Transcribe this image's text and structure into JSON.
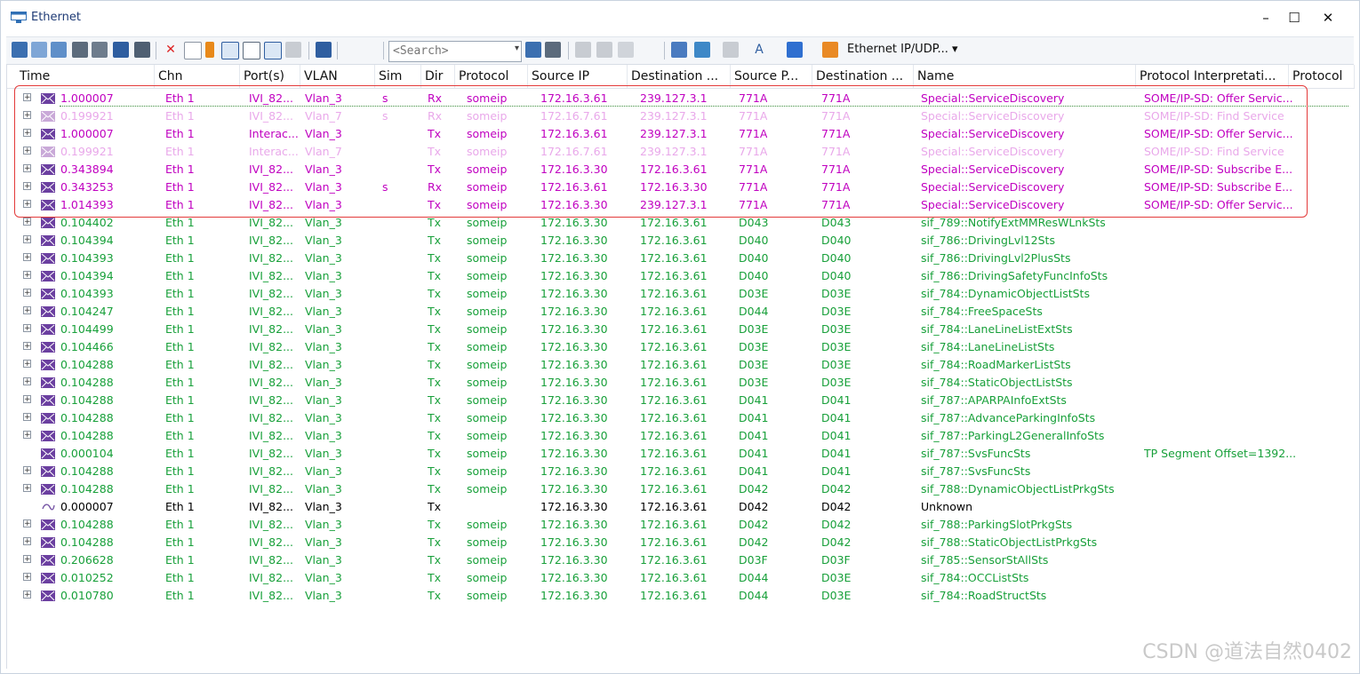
{
  "window": {
    "title": "Ethernet",
    "minimize": "–",
    "maximize": "☐",
    "close": "✕"
  },
  "toolbar": {
    "search_placeholder": "<Search>",
    "protocol_filter_label": "Ethernet IP/UDP... ▾"
  },
  "columns": [
    "Time",
    "Chn",
    "Port(s)",
    "VLAN",
    "Sim",
    "Dir",
    "Protocol",
    "Source IP",
    "Destination ...",
    "Source P...",
    "Destination ...",
    "Name",
    "Protocol Interpretati...",
    "Protocol"
  ],
  "rows": [
    {
      "time": "1.000007",
      "chn": "Eth 1",
      "port": "IVI_82...",
      "vlan": "Vlan_3",
      "sim": "s",
      "dir": "Rx",
      "protocol": "someip",
      "src": "172.16.3.61",
      "dst": "239.127.3.1",
      "sport": "771A",
      "dport": "771A",
      "name": "Special::ServiceDiscovery",
      "interp": "SOME/IP-SD: Offer Servic...",
      "style": "magenta",
      "icon": "envelope"
    },
    {
      "time": "0.199921",
      "chn": "Eth 1",
      "port": "IVI_82...",
      "vlan": "Vlan_7",
      "sim": "s",
      "dir": "Rx",
      "protocol": "someip",
      "src": "172.16.7.61",
      "dst": "239.127.3.1",
      "sport": "771A",
      "dport": "771A",
      "name": "Special::ServiceDiscovery",
      "interp": "SOME/IP-SD: Find Service",
      "style": "faded",
      "icon": "envelope"
    },
    {
      "time": "1.000007",
      "chn": "Eth 1",
      "port": "Interac...",
      "vlan": "Vlan_3",
      "sim": "",
      "dir": "Tx",
      "protocol": "someip",
      "src": "172.16.3.61",
      "dst": "239.127.3.1",
      "sport": "771A",
      "dport": "771A",
      "name": "Special::ServiceDiscovery",
      "interp": "SOME/IP-SD: Offer Servic...",
      "style": "magenta",
      "icon": "envelope"
    },
    {
      "time": "0.199921",
      "chn": "Eth 1",
      "port": "Interac...",
      "vlan": "Vlan_7",
      "sim": "",
      "dir": "Tx",
      "protocol": "someip",
      "src": "172.16.7.61",
      "dst": "239.127.3.1",
      "sport": "771A",
      "dport": "771A",
      "name": "Special::ServiceDiscovery",
      "interp": "SOME/IP-SD: Find Service",
      "style": "faded",
      "icon": "envelope"
    },
    {
      "time": "0.343894",
      "chn": "Eth 1",
      "port": "IVI_82...",
      "vlan": "Vlan_3",
      "sim": "",
      "dir": "Tx",
      "protocol": "someip",
      "src": "172.16.3.30",
      "dst": "172.16.3.61",
      "sport": "771A",
      "dport": "771A",
      "name": "Special::ServiceDiscovery",
      "interp": "SOME/IP-SD: Subscribe E...",
      "style": "magenta",
      "icon": "envelope"
    },
    {
      "time": "0.343253",
      "chn": "Eth 1",
      "port": "IVI_82...",
      "vlan": "Vlan_3",
      "sim": "s",
      "dir": "Rx",
      "protocol": "someip",
      "src": "172.16.3.61",
      "dst": "172.16.3.30",
      "sport": "771A",
      "dport": "771A",
      "name": "Special::ServiceDiscovery",
      "interp": "SOME/IP-SD: Subscribe E...",
      "style": "magenta",
      "icon": "envelope"
    },
    {
      "time": "1.014393",
      "chn": "Eth 1",
      "port": "IVI_82...",
      "vlan": "Vlan_3",
      "sim": "",
      "dir": "Tx",
      "protocol": "someip",
      "src": "172.16.3.30",
      "dst": "239.127.3.1",
      "sport": "771A",
      "dport": "771A",
      "name": "Special::ServiceDiscovery",
      "interp": "SOME/IP-SD: Offer Servic...",
      "style": "magenta",
      "icon": "envelope"
    },
    {
      "time": "0.104402",
      "chn": "Eth 1",
      "port": "IVI_82...",
      "vlan": "Vlan_3",
      "sim": "",
      "dir": "Tx",
      "protocol": "someip",
      "src": "172.16.3.30",
      "dst": "172.16.3.61",
      "sport": "D043",
      "dport": "D043",
      "name": "sif_789::NotifyExtMMResWLnkSts",
      "interp": "",
      "style": "green",
      "icon": "envelope"
    },
    {
      "time": "0.104394",
      "chn": "Eth 1",
      "port": "IVI_82...",
      "vlan": "Vlan_3",
      "sim": "",
      "dir": "Tx",
      "protocol": "someip",
      "src": "172.16.3.30",
      "dst": "172.16.3.61",
      "sport": "D040",
      "dport": "D040",
      "name": "sif_786::DrivingLvl12Sts",
      "interp": "",
      "style": "green",
      "icon": "envelope"
    },
    {
      "time": "0.104393",
      "chn": "Eth 1",
      "port": "IVI_82...",
      "vlan": "Vlan_3",
      "sim": "",
      "dir": "Tx",
      "protocol": "someip",
      "src": "172.16.3.30",
      "dst": "172.16.3.61",
      "sport": "D040",
      "dport": "D040",
      "name": "sif_786::DrivingLvl2PlusSts",
      "interp": "",
      "style": "green",
      "icon": "envelope"
    },
    {
      "time": "0.104394",
      "chn": "Eth 1",
      "port": "IVI_82...",
      "vlan": "Vlan_3",
      "sim": "",
      "dir": "Tx",
      "protocol": "someip",
      "src": "172.16.3.30",
      "dst": "172.16.3.61",
      "sport": "D040",
      "dport": "D040",
      "name": "sif_786::DrivingSafetyFuncInfoSts",
      "interp": "",
      "style": "green",
      "icon": "envelope"
    },
    {
      "time": "0.104393",
      "chn": "Eth 1",
      "port": "IVI_82...",
      "vlan": "Vlan_3",
      "sim": "",
      "dir": "Tx",
      "protocol": "someip",
      "src": "172.16.3.30",
      "dst": "172.16.3.61",
      "sport": "D03E",
      "dport": "D03E",
      "name": "sif_784::DynamicObjectListSts",
      "interp": "",
      "style": "green",
      "icon": "envelope"
    },
    {
      "time": "0.104247",
      "chn": "Eth 1",
      "port": "IVI_82...",
      "vlan": "Vlan_3",
      "sim": "",
      "dir": "Tx",
      "protocol": "someip",
      "src": "172.16.3.30",
      "dst": "172.16.3.61",
      "sport": "D044",
      "dport": "D03E",
      "name": "sif_784::FreeSpaceSts",
      "interp": "",
      "style": "green",
      "icon": "envelope"
    },
    {
      "time": "0.104499",
      "chn": "Eth 1",
      "port": "IVI_82...",
      "vlan": "Vlan_3",
      "sim": "",
      "dir": "Tx",
      "protocol": "someip",
      "src": "172.16.3.30",
      "dst": "172.16.3.61",
      "sport": "D03E",
      "dport": "D03E",
      "name": "sif_784::LaneLineListExtSts",
      "interp": "",
      "style": "green",
      "icon": "envelope"
    },
    {
      "time": "0.104466",
      "chn": "Eth 1",
      "port": "IVI_82...",
      "vlan": "Vlan_3",
      "sim": "",
      "dir": "Tx",
      "protocol": "someip",
      "src": "172.16.3.30",
      "dst": "172.16.3.61",
      "sport": "D03E",
      "dport": "D03E",
      "name": "sif_784::LaneLineListSts",
      "interp": "",
      "style": "green",
      "icon": "envelope"
    },
    {
      "time": "0.104288",
      "chn": "Eth 1",
      "port": "IVI_82...",
      "vlan": "Vlan_3",
      "sim": "",
      "dir": "Tx",
      "protocol": "someip",
      "src": "172.16.3.30",
      "dst": "172.16.3.61",
      "sport": "D03E",
      "dport": "D03E",
      "name": "sif_784::RoadMarkerListSts",
      "interp": "",
      "style": "green",
      "icon": "envelope"
    },
    {
      "time": "0.104288",
      "chn": "Eth 1",
      "port": "IVI_82...",
      "vlan": "Vlan_3",
      "sim": "",
      "dir": "Tx",
      "protocol": "someip",
      "src": "172.16.3.30",
      "dst": "172.16.3.61",
      "sport": "D03E",
      "dport": "D03E",
      "name": "sif_784::StaticObjectListSts",
      "interp": "",
      "style": "green",
      "icon": "envelope"
    },
    {
      "time": "0.104288",
      "chn": "Eth 1",
      "port": "IVI_82...",
      "vlan": "Vlan_3",
      "sim": "",
      "dir": "Tx",
      "protocol": "someip",
      "src": "172.16.3.30",
      "dst": "172.16.3.61",
      "sport": "D041",
      "dport": "D041",
      "name": "sif_787::APARPAInfoExtSts",
      "interp": "",
      "style": "green",
      "icon": "envelope"
    },
    {
      "time": "0.104288",
      "chn": "Eth 1",
      "port": "IVI_82...",
      "vlan": "Vlan_3",
      "sim": "",
      "dir": "Tx",
      "protocol": "someip",
      "src": "172.16.3.30",
      "dst": "172.16.3.61",
      "sport": "D041",
      "dport": "D041",
      "name": "sif_787::AdvanceParkingInfoSts",
      "interp": "",
      "style": "green",
      "icon": "envelope"
    },
    {
      "time": "0.104288",
      "chn": "Eth 1",
      "port": "IVI_82...",
      "vlan": "Vlan_3",
      "sim": "",
      "dir": "Tx",
      "protocol": "someip",
      "src": "172.16.3.30",
      "dst": "172.16.3.61",
      "sport": "D041",
      "dport": "D041",
      "name": "sif_787::ParkingL2GeneralInfoSts",
      "interp": "",
      "style": "green",
      "icon": "envelope"
    },
    {
      "time": "0.000104",
      "chn": "Eth 1",
      "port": "IVI_82...",
      "vlan": "Vlan_3",
      "sim": "",
      "dir": "Tx",
      "protocol": "someip",
      "src": "172.16.3.30",
      "dst": "172.16.3.61",
      "sport": "D041",
      "dport": "D041",
      "name": "sif_787::SvsFuncSts",
      "interp": "TP Segment Offset=1392...",
      "style": "green",
      "icon": "envelope-small"
    },
    {
      "time": "0.104288",
      "chn": "Eth 1",
      "port": "IVI_82...",
      "vlan": "Vlan_3",
      "sim": "",
      "dir": "Tx",
      "protocol": "someip",
      "src": "172.16.3.30",
      "dst": "172.16.3.61",
      "sport": "D041",
      "dport": "D041",
      "name": "sif_787::SvsFuncSts",
      "interp": "",
      "style": "green",
      "icon": "envelope"
    },
    {
      "time": "0.104288",
      "chn": "Eth 1",
      "port": "IVI_82...",
      "vlan": "Vlan_3",
      "sim": "",
      "dir": "Tx",
      "protocol": "someip",
      "src": "172.16.3.30",
      "dst": "172.16.3.61",
      "sport": "D042",
      "dport": "D042",
      "name": "sif_788::DynamicObjectListPrkgSts",
      "interp": "",
      "style": "green",
      "icon": "envelope"
    },
    {
      "time": "0.000007",
      "chn": "Eth 1",
      "port": "IVI_82...",
      "vlan": "Vlan_3",
      "sim": "",
      "dir": "Tx",
      "protocol": "",
      "src": "172.16.3.30",
      "dst": "172.16.3.61",
      "sport": "D042",
      "dport": "D042",
      "name": "Unknown",
      "interp": "",
      "style": "black",
      "icon": "unknown"
    },
    {
      "time": "0.104288",
      "chn": "Eth 1",
      "port": "IVI_82...",
      "vlan": "Vlan_3",
      "sim": "",
      "dir": "Tx",
      "protocol": "someip",
      "src": "172.16.3.30",
      "dst": "172.16.3.61",
      "sport": "D042",
      "dport": "D042",
      "name": "sif_788::ParkingSlotPrkgSts",
      "interp": "",
      "style": "green",
      "icon": "envelope"
    },
    {
      "time": "0.104288",
      "chn": "Eth 1",
      "port": "IVI_82...",
      "vlan": "Vlan_3",
      "sim": "",
      "dir": "Tx",
      "protocol": "someip",
      "src": "172.16.3.30",
      "dst": "172.16.3.61",
      "sport": "D042",
      "dport": "D042",
      "name": "sif_788::StaticObjectListPrkgSts",
      "interp": "",
      "style": "green",
      "icon": "envelope"
    },
    {
      "time": "0.206628",
      "chn": "Eth 1",
      "port": "IVI_82...",
      "vlan": "Vlan_3",
      "sim": "",
      "dir": "Tx",
      "protocol": "someip",
      "src": "172.16.3.30",
      "dst": "172.16.3.61",
      "sport": "D03F",
      "dport": "D03F",
      "name": "sif_785::SensorStAllSts",
      "interp": "",
      "style": "green",
      "icon": "envelope"
    },
    {
      "time": "0.010252",
      "chn": "Eth 1",
      "port": "IVI_82...",
      "vlan": "Vlan_3",
      "sim": "",
      "dir": "Tx",
      "protocol": "someip",
      "src": "172.16.3.30",
      "dst": "172.16.3.61",
      "sport": "D044",
      "dport": "D03E",
      "name": "sif_784::OCCListSts",
      "interp": "",
      "style": "green",
      "icon": "envelope"
    },
    {
      "time": "0.010780",
      "chn": "Eth 1",
      "port": "IVI_82...",
      "vlan": "Vlan_3",
      "sim": "",
      "dir": "Tx",
      "protocol": "someip",
      "src": "172.16.3.30",
      "dst": "172.16.3.61",
      "sport": "D044",
      "dport": "D03E",
      "name": "sif_784::RoadStructSts",
      "interp": "",
      "style": "green",
      "icon": "envelope"
    }
  ],
  "watermark": "CSDN @道法自然0402",
  "colors": {
    "magenta": "#c000c0",
    "faded": "#e9a8ea",
    "green": "#18a03a",
    "highlight": "#e33a3a"
  }
}
